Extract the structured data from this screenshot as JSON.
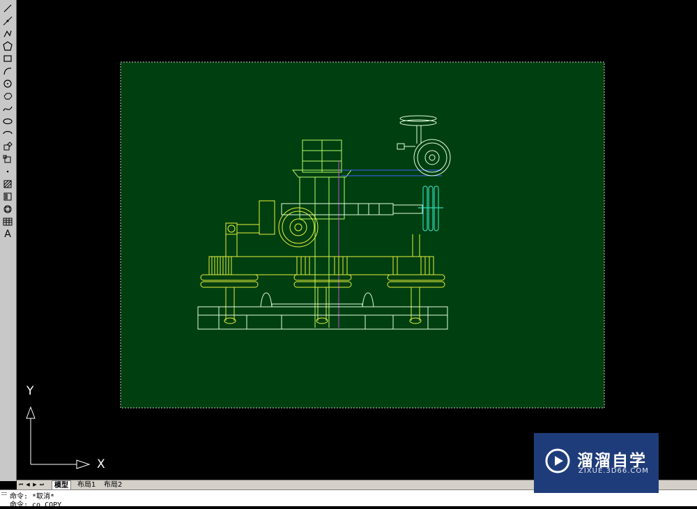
{
  "toolbar": {
    "tools": [
      {
        "name": "line-tool-icon"
      },
      {
        "name": "construction-line-tool-icon"
      },
      {
        "name": "polyline-tool-icon"
      },
      {
        "name": "polygon-tool-icon"
      },
      {
        "name": "rectangle-tool-icon"
      },
      {
        "name": "arc-tool-icon"
      },
      {
        "name": "circle-tool-icon"
      },
      {
        "name": "revision-cloud-tool-icon"
      },
      {
        "name": "spline-tool-icon"
      },
      {
        "name": "ellipse-tool-icon"
      },
      {
        "name": "ellipse-arc-tool-icon"
      },
      {
        "name": "insert-block-tool-icon"
      },
      {
        "name": "make-block-tool-icon"
      },
      {
        "name": "point-tool-icon"
      },
      {
        "name": "hatch-tool-icon"
      },
      {
        "name": "gradient-tool-icon"
      },
      {
        "name": "region-tool-icon"
      },
      {
        "name": "table-tool-icon"
      },
      {
        "name": "multiline-text-tool-icon",
        "glyph": "A"
      }
    ]
  },
  "ucs": {
    "x_label": "X",
    "y_label": "Y"
  },
  "tabs": {
    "items": [
      {
        "label": "模型",
        "active": true
      },
      {
        "label": "布局1",
        "active": false
      },
      {
        "label": "布局2",
        "active": false
      }
    ]
  },
  "command": {
    "line1": "命令: *取消*",
    "line2": "命令: co COPY"
  },
  "watermark": {
    "title": "溜溜自学",
    "url": "ZIXUE.3D66.COM"
  },
  "colors": {
    "paper": "#003f10",
    "drawing_yellow": "#e6f23c",
    "drawing_green": "#b4ff6a",
    "drawing_cyan": "#2ed6b4",
    "drawing_white": "#e0ffe0",
    "drawing_magenta": "#c050d0",
    "drawing_blue": "#4060ff"
  }
}
